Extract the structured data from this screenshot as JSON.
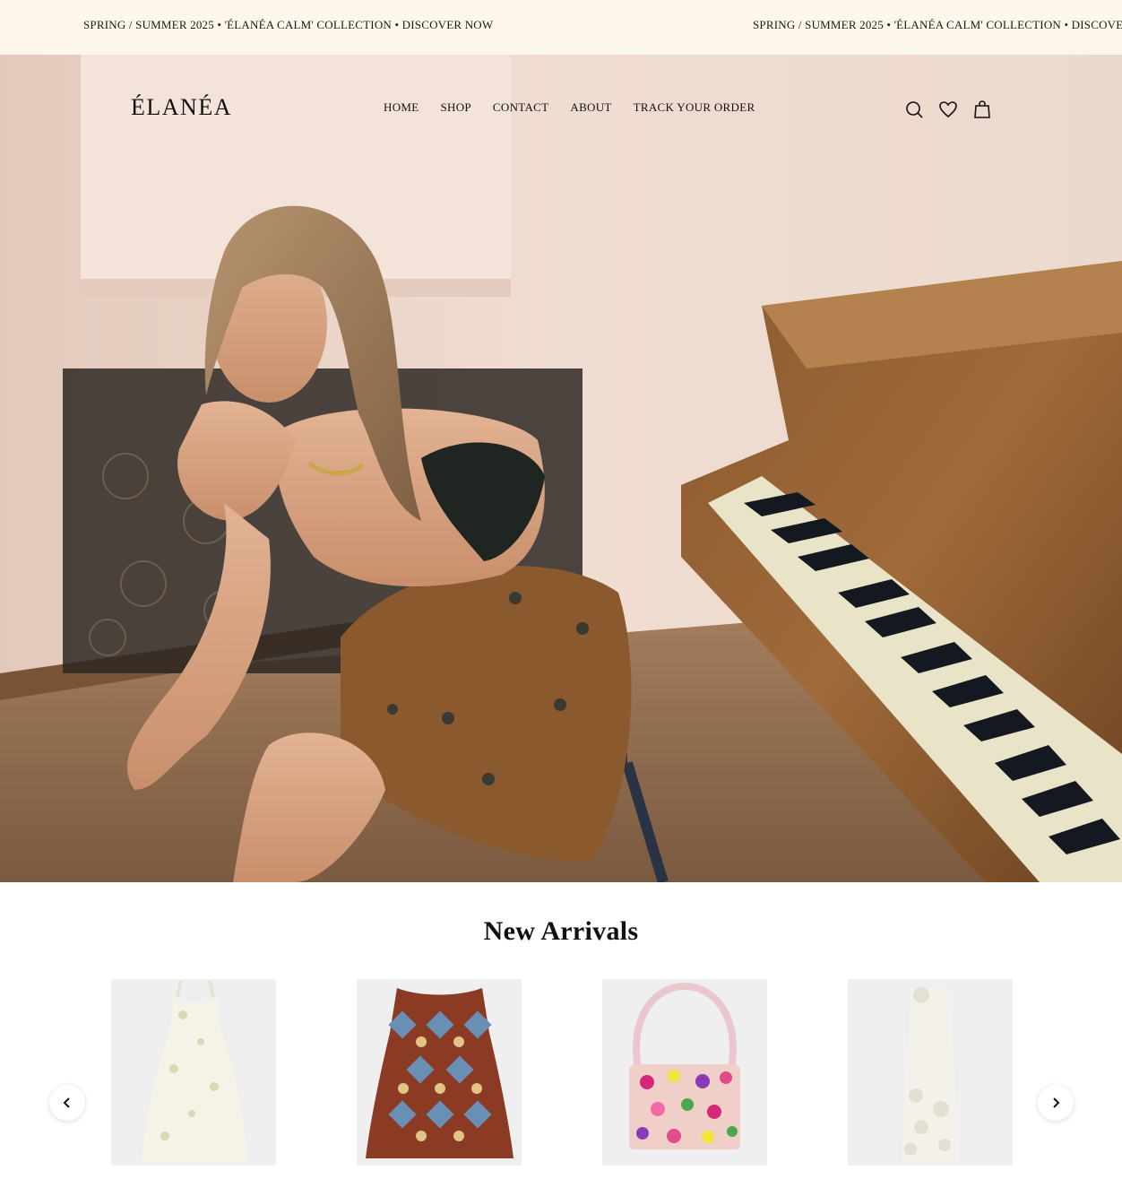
{
  "announcement": {
    "text": "SPRING / SUMMER 2025 • 'ÉLANÉA CALM' COLLECTION • DISCOVER NOW",
    "text_repeat": "SPRING / SUMMER 2025 • 'ÉLANÉA CALM' COLLECTION • DISCOVE"
  },
  "header": {
    "logo": "ÉLANÉA",
    "nav": [
      "HOME",
      "SHOP",
      "CONTACT",
      "ABOUT",
      "TRACK YOUR ORDER"
    ],
    "icons": [
      "search-icon",
      "heart-icon",
      "shopping-bag-icon"
    ]
  },
  "hero": {
    "image": "model seated beside grand piano"
  },
  "new_arrivals": {
    "title": "New Arrivals",
    "products": [
      {
        "name": "white floral embroidered midi dress"
      },
      {
        "name": "patterned sleeveless top"
      },
      {
        "name": "beaded floral shoulder bag"
      },
      {
        "name": "white lace maxi dress"
      }
    ]
  },
  "colors": {
    "announce_bg": "#fdf6ea",
    "text": "#111111",
    "product_bg": "#efefef"
  }
}
